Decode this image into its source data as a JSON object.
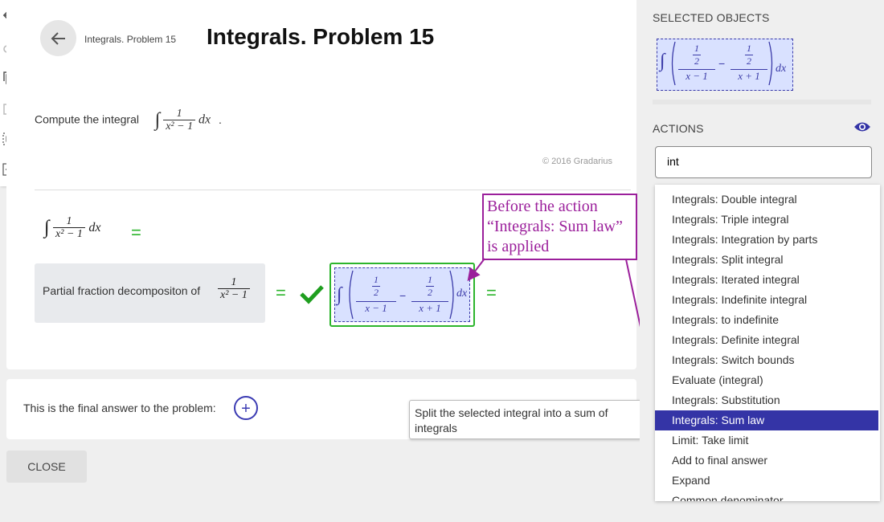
{
  "header": {
    "breadcrumb": "Integrals. Problem 15",
    "title": "Integrals. Problem 15"
  },
  "problem": {
    "prompt": "Compute the integral",
    "integrand_num": "1",
    "integrand_den": "x² − 1",
    "dx": "dx",
    "period": "."
  },
  "copyright": "© 2016 Gradarius",
  "solution": {
    "step_label": "Partial fraction decompositon of",
    "frac_num": "1",
    "frac_den": "x² − 1",
    "half": "1",
    "two": "2",
    "den_minus": "x − 1",
    "den_plus": "x + 1",
    "minus": "−",
    "equals": "="
  },
  "final_answer": {
    "label": "This is the final answer to the problem:",
    "add_symbol": "+"
  },
  "close_label": "CLOSE",
  "tooltip": "Split the selected integral into a sum of integrals",
  "annotation": "Before the action “Integrals: Sum law” is applied",
  "panel": {
    "selected_heading": "SELECTED OBJECTS",
    "actions_heading": "ACTIONS",
    "search_value": "int",
    "actions": [
      "Integrals: Double integral",
      "Integrals: Triple integral",
      "Integrals: Integration by parts",
      "Integrals: Split integral",
      "Integrals: Iterated integral",
      "Integrals: Indefinite integral",
      "Integrals: to indefinite",
      "Integrals: Definite integral",
      "Integrals: Switch bounds",
      "Evaluate (integral)",
      "Integrals: Substitution",
      "Integrals: Sum law",
      "Limit: Take limit",
      "Add to final answer",
      "Expand",
      "Common denominator"
    ],
    "selected_action": "Integrals: Sum law"
  },
  "colors": {
    "accent": "#3434a6",
    "success": "#2db52d",
    "annotation": "#9b1f9b",
    "selection_fill": "#d9e1ff"
  },
  "icons": [
    "undo-icon",
    "redo-icon",
    "copy-icon",
    "paste-icon",
    "select-icon",
    "add-box-icon",
    "back-arrow-icon",
    "check-icon",
    "eye-icon",
    "plus-icon"
  ]
}
